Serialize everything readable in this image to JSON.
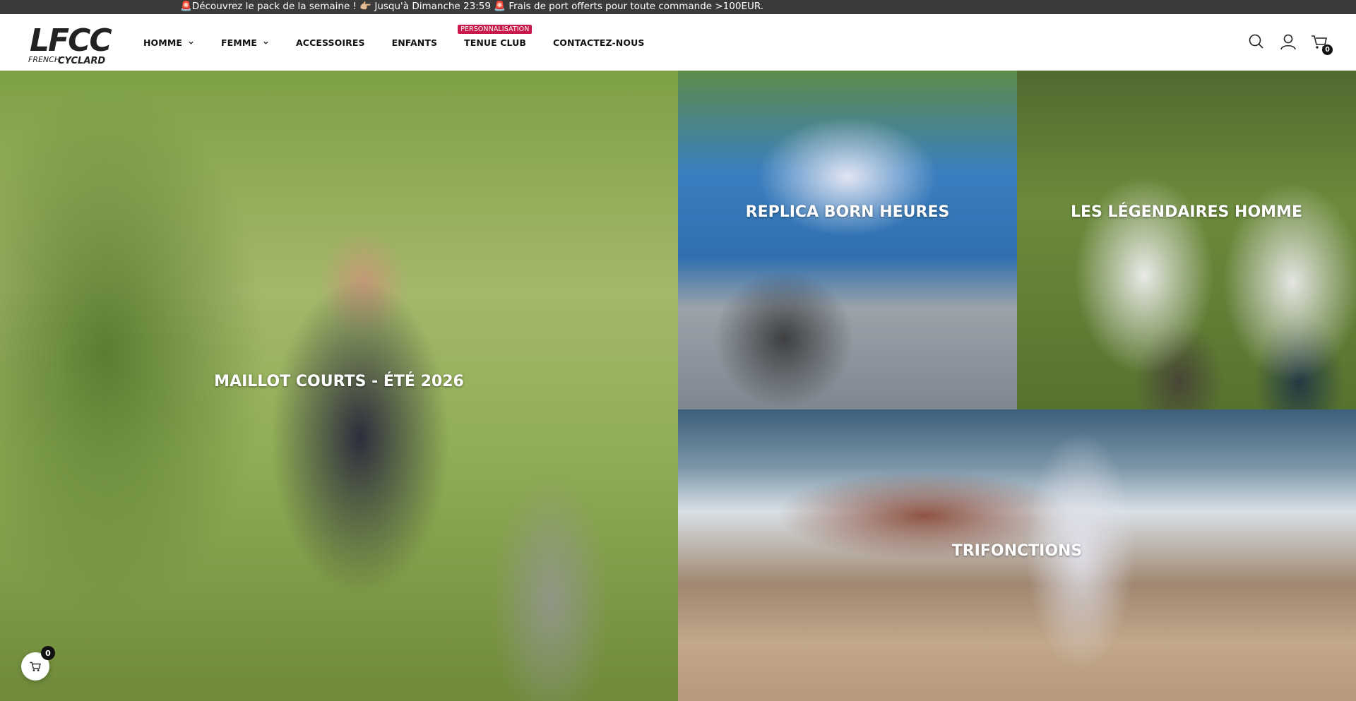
{
  "announcement": {
    "text": "🚨Découvrez le pack de la semaine ! 👉🏼 Jusqu'à Dimanche 23:59 🚨 Frais de port offerts pour toute commande >100EUR."
  },
  "logo": {
    "alt": "LFCC French Cyclard"
  },
  "nav": {
    "items": [
      {
        "label": "HOMME",
        "has_dropdown": true
      },
      {
        "label": "FEMME",
        "has_dropdown": true
      },
      {
        "label": "ACCESSOIRES"
      },
      {
        "label": "ENFANTS"
      },
      {
        "label": "TENUE CLUB",
        "badge": "PERSONNALISATION"
      },
      {
        "label": "CONTACTEZ-NOUS"
      }
    ]
  },
  "header_icons": {
    "search": "search-icon",
    "account": "user-icon",
    "cart": "cart-icon",
    "cart_count": "0"
  },
  "tiles": {
    "main": {
      "label": "MAILLOT COURTS - ÉTÉ 2026"
    },
    "replica": {
      "label": "REPLICA BORN HEURES"
    },
    "legendaires": {
      "label": "LES LÉGENDAIRES HOMME"
    },
    "tri": {
      "label": "TRIFONCTIONS"
    }
  },
  "floating_cart": {
    "count": "0"
  },
  "colors": {
    "topbar": "#3a3a3a",
    "badge": "#c9184a"
  }
}
